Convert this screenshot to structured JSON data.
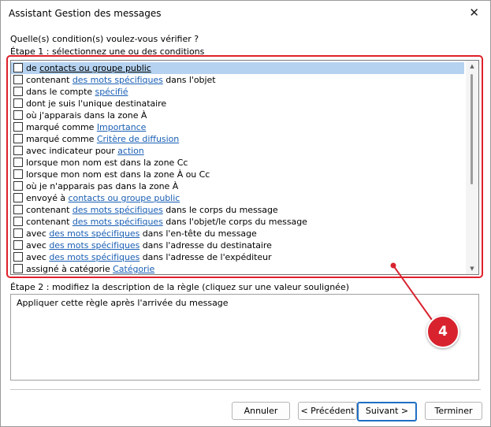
{
  "window": {
    "title": "Assistant Gestion des messages",
    "close_glyph": "✕"
  },
  "question": "Quelle(s) condition(s) voulez-vous vérifier ?",
  "step1_label": "Étape 1 : sélectionnez une ou des conditions",
  "conditions": [
    {
      "selected": true,
      "parts": [
        {
          "t": "de "
        },
        {
          "t": "contacts ou groupe public",
          "link": true
        }
      ]
    },
    {
      "selected": false,
      "parts": [
        {
          "t": "contenant "
        },
        {
          "t": "des mots spécifiques",
          "link": true
        },
        {
          "t": " dans l'objet"
        }
      ]
    },
    {
      "selected": false,
      "parts": [
        {
          "t": "dans le compte "
        },
        {
          "t": "spécifié",
          "link": true
        }
      ]
    },
    {
      "selected": false,
      "parts": [
        {
          "t": "dont je suis l'unique destinataire"
        }
      ]
    },
    {
      "selected": false,
      "parts": [
        {
          "t": "où j'apparais dans la zone À"
        }
      ]
    },
    {
      "selected": false,
      "parts": [
        {
          "t": "marqué comme "
        },
        {
          "t": "Importance",
          "link": true
        }
      ]
    },
    {
      "selected": false,
      "parts": [
        {
          "t": "marqué comme "
        },
        {
          "t": "Critère de diffusion",
          "link": true
        }
      ]
    },
    {
      "selected": false,
      "parts": [
        {
          "t": "avec indicateur pour "
        },
        {
          "t": "action ",
          "link": true
        }
      ]
    },
    {
      "selected": false,
      "parts": [
        {
          "t": "lorsque mon nom est dans la zone Cc"
        }
      ]
    },
    {
      "selected": false,
      "parts": [
        {
          "t": "lorsque mon nom est dans la zone À ou Cc"
        }
      ]
    },
    {
      "selected": false,
      "parts": [
        {
          "t": "où je n'apparais pas dans la zone À"
        }
      ]
    },
    {
      "selected": false,
      "parts": [
        {
          "t": "envoyé à "
        },
        {
          "t": "contacts ou groupe public",
          "link": true
        }
      ]
    },
    {
      "selected": false,
      "parts": [
        {
          "t": "contenant "
        },
        {
          "t": "des mots spécifiques",
          "link": true
        },
        {
          "t": " dans le corps du message"
        }
      ]
    },
    {
      "selected": false,
      "parts": [
        {
          "t": "contenant "
        },
        {
          "t": "des mots spécifiques",
          "link": true
        },
        {
          "t": " dans l'objet/le corps du message"
        }
      ]
    },
    {
      "selected": false,
      "parts": [
        {
          "t": "avec "
        },
        {
          "t": "des mots spécifiques",
          "link": true
        },
        {
          "t": " dans l'en-tête du message"
        }
      ]
    },
    {
      "selected": false,
      "parts": [
        {
          "t": "avec "
        },
        {
          "t": "des mots spécifiques",
          "link": true
        },
        {
          "t": " dans l'adresse du destinataire"
        }
      ]
    },
    {
      "selected": false,
      "parts": [
        {
          "t": "avec "
        },
        {
          "t": "des mots spécifiques",
          "link": true
        },
        {
          "t": " dans l'adresse de l'expéditeur"
        }
      ]
    },
    {
      "selected": false,
      "parts": [
        {
          "t": "assigné à catégorie "
        },
        {
          "t": "Catégorie",
          "link": true
        }
      ]
    }
  ],
  "step2_label": "Étape 2 : modifiez la description de la règle (cliquez sur une valeur soulignée)",
  "rule_description": "Appliquer cette règle après l'arrivée du message",
  "buttons": {
    "cancel": "Annuler",
    "back": "< Précédent",
    "next": "Suivant >",
    "finish": "Terminer"
  },
  "callout": {
    "number": "4",
    "color": "#d8232f"
  },
  "colors": {
    "link": "#1a5fb4",
    "selection": "#b5d3f0",
    "highlight_border": "#e0202a",
    "primary_button_border": "#1f6fc5"
  }
}
